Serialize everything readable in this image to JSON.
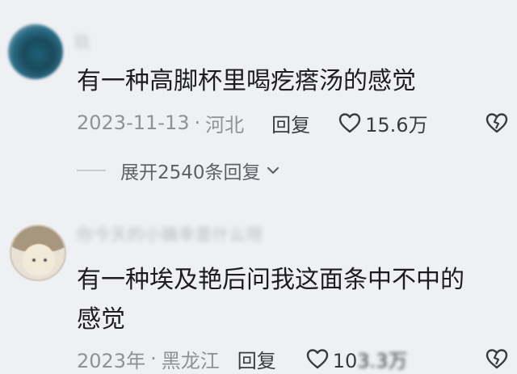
{
  "comments": [
    {
      "username": "玖",
      "content": "有一种高脚杯里喝疙瘩汤的感觉",
      "time": "2023-11-13",
      "separator": "·",
      "location": "河北",
      "reply_label": "回复",
      "likes": "15.6万",
      "expand_label": "展开2540条回复"
    },
    {
      "username": "你今天的小确幸是什么呀",
      "content": "有一种埃及艳后问我这面条中不中的\n感觉",
      "time": "2023年",
      "separator": "·",
      "location": "黑龙江",
      "reply_label": "回复",
      "likes_visible": "10",
      "likes_obscured": "3.3万"
    }
  ],
  "icons": {
    "like": "heart-outline-icon",
    "dislike": "broken-heart-icon",
    "expand": "chevron-down-icon"
  },
  "colors": {
    "background": "#eef0f3",
    "meta_text": "#8e9196",
    "content_text": "#1d1d1f"
  }
}
